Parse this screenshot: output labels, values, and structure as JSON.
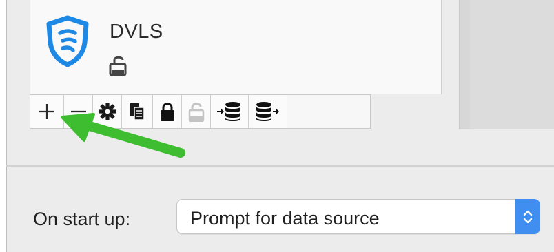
{
  "data_source": {
    "name": "DVLS",
    "icon": "shield-icon",
    "icon_color": "#1e88e5",
    "lock_icon": "lock-open-icon"
  },
  "toolbar": {
    "buttons": [
      {
        "name": "add-button",
        "icon": "plus-icon"
      },
      {
        "name": "remove-button",
        "icon": "minus-icon"
      },
      {
        "name": "settings-button",
        "icon": "gear-icon"
      },
      {
        "name": "duplicate-button",
        "icon": "copy-icon"
      },
      {
        "name": "lock-button",
        "icon": "lock-closed-icon"
      },
      {
        "name": "unlock-button",
        "icon": "lock-open-icon",
        "disabled": true
      },
      {
        "name": "import-database-button",
        "icon": "database-import-icon"
      },
      {
        "name": "export-database-button",
        "icon": "database-export-icon"
      }
    ]
  },
  "annotation": {
    "icon": "arrow-icon",
    "color": "#3dbd2f"
  },
  "startup": {
    "label": "On start up:",
    "selected": "Prompt for data source",
    "accent_color": "#3f8ef0"
  }
}
